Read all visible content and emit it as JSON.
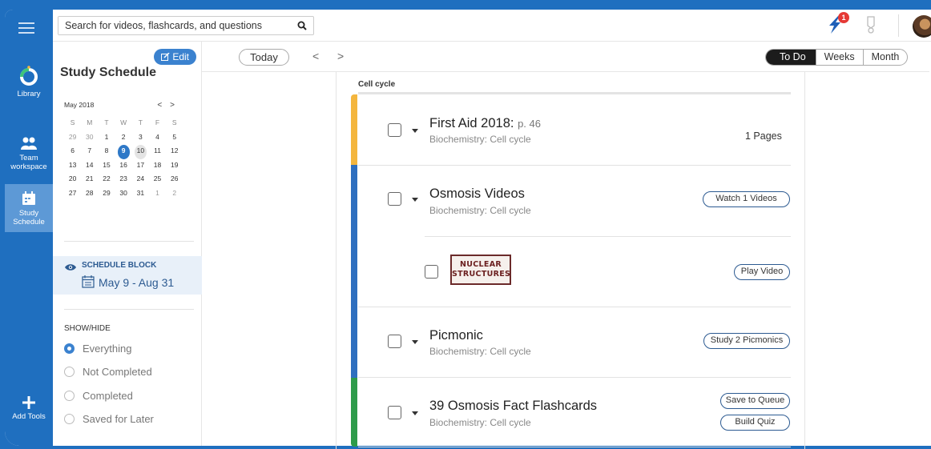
{
  "rail": {
    "items": [
      {
        "label": "Library"
      },
      {
        "label_line1": "Team",
        "label_line2": "workspace"
      },
      {
        "label_line1": "Study",
        "label_line2": "Schedule"
      },
      {
        "label": "Add Tools"
      }
    ]
  },
  "search": {
    "placeholder": "Search for videos, flashcards, and questions"
  },
  "notifications": {
    "count": "1"
  },
  "sidebar": {
    "title": "Study Schedule",
    "edit_label": "Edit",
    "calendar": {
      "month": "May 2018",
      "prev": "<",
      "next": ">",
      "days_of_week": [
        "S",
        "M",
        "T",
        "W",
        "T",
        "F",
        "S"
      ],
      "weeks": [
        [
          "29",
          "30",
          "1",
          "2",
          "3",
          "4",
          "5"
        ],
        [
          "6",
          "7",
          "8",
          "9",
          "10",
          "11",
          "12"
        ],
        [
          "13",
          "14",
          "15",
          "16",
          "17",
          "18",
          "19"
        ],
        [
          "20",
          "21",
          "22",
          "23",
          "24",
          "25",
          "26"
        ],
        [
          "27",
          "28",
          "29",
          "30",
          "31",
          "1",
          "2"
        ]
      ]
    },
    "schedule_block": {
      "label": "SCHEDULE BLOCK",
      "dates": "May 9 - Aug 31"
    },
    "show_hide": {
      "label": "SHOW/HIDE",
      "options": [
        "Everything",
        "Not Completed",
        "Completed",
        "Saved for Later"
      ],
      "selected": "Everything"
    }
  },
  "controls": {
    "today": "Today",
    "prev": "<",
    "next": ">",
    "views": [
      "To Do",
      "Weeks",
      "Month"
    ],
    "active_view": "To Do"
  },
  "section": {
    "title": "Cell cycle"
  },
  "tasks": [
    {
      "title": "First Aid 2018:",
      "page": "p. 46",
      "subtitle": "Biochemistry: Cell cycle",
      "meta": "1 Pages",
      "color": "#f4b63e"
    },
    {
      "title": "Osmosis Videos",
      "subtitle": "Biochemistry: Cell cycle",
      "action": "Watch 1 Videos",
      "color": "#2e6fbf",
      "sub_item": {
        "thumb_line1": "NUCLEAR",
        "thumb_line2": "STRUCTURES",
        "action": "Play Video"
      }
    },
    {
      "title": "Picmonic",
      "subtitle": "Biochemistry: Cell cycle",
      "action": "Study 2 Picmonics",
      "color": "#2e6fbf"
    },
    {
      "title": "39 Osmosis Fact Flashcards",
      "subtitle": "Biochemistry: Cell cycle",
      "action1": "Save to Queue",
      "action2": "Build Quiz",
      "color": "#2e9b4a"
    }
  ]
}
